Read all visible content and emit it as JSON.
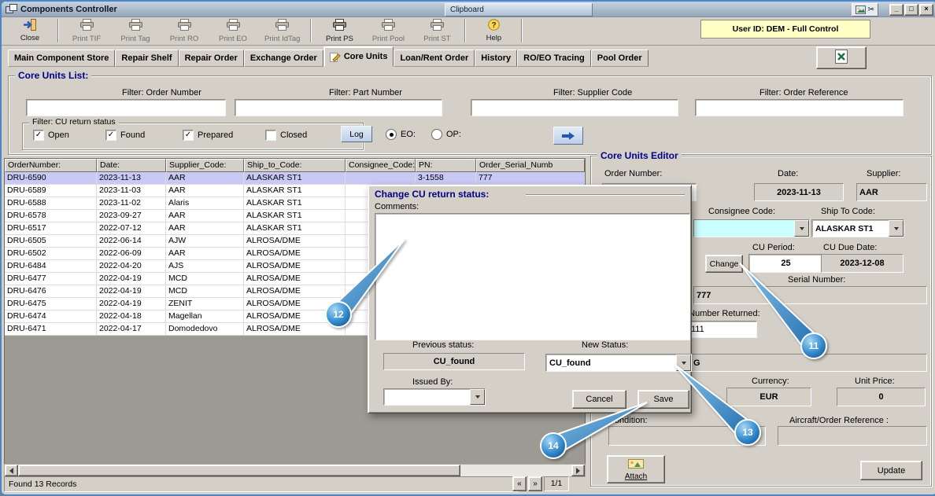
{
  "window": {
    "title": "Components Controller",
    "floating_title": "Clipboard",
    "controls": {
      "minimize": "_",
      "restore": "□",
      "close": "×"
    },
    "tools": {
      "scissors": "✂"
    }
  },
  "toolbar": {
    "buttons": [
      "Close",
      "Print TIF",
      "Print Tag",
      "Print RO",
      "Print EO",
      "Print IdTag",
      "Print PS",
      "Print Pool",
      "Print ST",
      "Help"
    ],
    "user_id": "User ID: DEM - Full Control"
  },
  "tabs": [
    "Main Component Store",
    "Repair Shelf",
    "Repair Order",
    "Exchange Order",
    "Core Units",
    "Loan/Rent Order",
    "History",
    "RO/EO Tracing",
    "Pool Order"
  ],
  "active_tab_index": 4,
  "filters": {
    "group_title": "Core Units List:",
    "labels": [
      "Filter: Order Number",
      "Filter: Part Number",
      "Filter: Supplier Code",
      "Filter: Order Reference"
    ],
    "status_group_title": "Filter: CU return status",
    "checkboxes": [
      {
        "label": "Open",
        "checked": true
      },
      {
        "label": "Found",
        "checked": true
      },
      {
        "label": "Prepared",
        "checked": true
      },
      {
        "label": "Closed",
        "checked": false
      }
    ],
    "log_button": "Log",
    "radios": [
      {
        "label": "EO:",
        "checked": true
      },
      {
        "label": "OP:",
        "checked": false
      }
    ]
  },
  "table": {
    "columns": [
      "OrderNumber:",
      "Date:",
      "Supplier_Code:",
      "Ship_to_Code:",
      "Consignee_Code:",
      "PN:",
      "Order_Serial_Numb"
    ],
    "selected_row": 0,
    "rows": [
      [
        "DRU-6590",
        "2023-11-13",
        "AAR",
        "ALASKAR ST1",
        "",
        "3-1558",
        "777"
      ],
      [
        "DRU-6589",
        "2023-11-03",
        "AAR",
        "ALASKAR ST1",
        "",
        "",
        ""
      ],
      [
        "DRU-6588",
        "2023-11-02",
        "Alaris",
        "ALASKAR ST1",
        "",
        "",
        ""
      ],
      [
        "DRU-6578",
        "2023-09-27",
        "AAR",
        "ALASKAR ST1",
        "",
        "",
        ""
      ],
      [
        "DRU-6517",
        "2022-07-12",
        "AAR",
        "ALASKAR ST1",
        "",
        "",
        ""
      ],
      [
        "DRU-6505",
        "2022-06-14",
        "AJW",
        "ALROSA/DME",
        "",
        "",
        ""
      ],
      [
        "DRU-6502",
        "2022-06-09",
        "AAR",
        "ALROSA/DME",
        "",
        "",
        ""
      ],
      [
        "DRU-6484",
        "2022-04-20",
        "AJS",
        "ALROSA/DME",
        "",
        "",
        ""
      ],
      [
        "DRU-6477",
        "2022-04-19",
        "MCD",
        "ALROSA/DME",
        "",
        "",
        ""
      ],
      [
        "DRU-6476",
        "2022-04-19",
        "MCD",
        "ALROSA/DME",
        "",
        "",
        ""
      ],
      [
        "DRU-6475",
        "2022-04-19",
        "ZENIT",
        "ALROSA/DME",
        "",
        "",
        ""
      ],
      [
        "DRU-6474",
        "2022-04-18",
        "Magellan",
        "ALROSA/DME",
        "",
        "",
        ""
      ],
      [
        "DRU-6471",
        "2022-04-17",
        "Domodedovo",
        "ALROSA/DME",
        "",
        "",
        ""
      ]
    ],
    "status_text": "Found 13 Records",
    "pager": {
      "prev": "«",
      "next": "»",
      "label": "1/1"
    }
  },
  "editor": {
    "title": "Core Units Editor",
    "order_number_label": "Order Number:",
    "date_label": "Date:",
    "date_value": "2023-11-13",
    "supplier_label": "Supplier:",
    "supplier_value": "AAR",
    "consignee_label": "Consignee Code:",
    "ship_to_label": "Ship To Code:",
    "ship_to_value": "ALASKAR ST1",
    "cu_period_label": "CU Period:",
    "cu_period_value": "25",
    "cu_due_label": "CU Due Date:",
    "cu_due_value": "2023-12-08",
    "change_button": "Change",
    "serial_label": "Serial Number:",
    "serial_value": "777",
    "serial_returned_label": "Serial Number Returned:",
    "serial_returned_value": "111",
    "description_value": "G",
    "currency_label": "Currency:",
    "currency_value": "EUR",
    "unit_price_label": "Unit Price:",
    "unit_price_value": "0",
    "condition_label": "Condition:",
    "aircraft_ref_label": "Aircraft/Order Reference :",
    "attach_button": "Attach",
    "update_button": "Update"
  },
  "dialog": {
    "title": "Change CU return status:",
    "comments_label": "Comments:",
    "previous_status_label": "Previous status:",
    "previous_status_value": "CU_found",
    "new_status_label": "New Status:",
    "new_status_value": "CU_found",
    "issued_by_label": "Issued By:",
    "cancel_button": "Cancel",
    "save_button": "Save"
  },
  "annotations": [
    {
      "number": "11"
    },
    {
      "number": "12"
    },
    {
      "number": "13"
    },
    {
      "number": "14"
    }
  ]
}
